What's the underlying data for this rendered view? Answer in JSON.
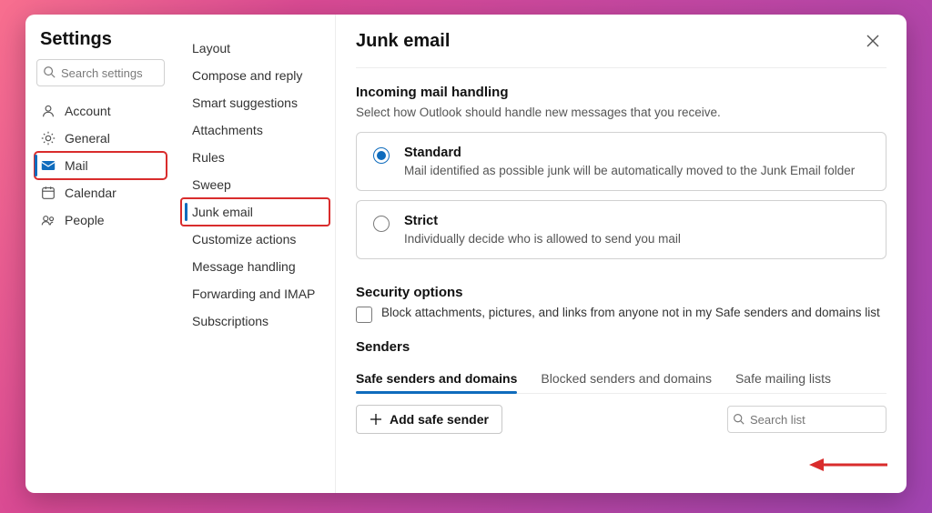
{
  "title": "Settings",
  "search": {
    "placeholder": "Search settings"
  },
  "nav": {
    "items": [
      {
        "label": "Account",
        "icon": "person"
      },
      {
        "label": "General",
        "icon": "gear"
      },
      {
        "label": "Mail",
        "icon": "mail",
        "active": true,
        "highlight": true
      },
      {
        "label": "Calendar",
        "icon": "calendar"
      },
      {
        "label": "People",
        "icon": "people"
      }
    ]
  },
  "subnav": {
    "items": [
      {
        "label": "Layout"
      },
      {
        "label": "Compose and reply"
      },
      {
        "label": "Smart suggestions"
      },
      {
        "label": "Attachments"
      },
      {
        "label": "Rules"
      },
      {
        "label": "Sweep"
      },
      {
        "label": "Junk email",
        "active": true,
        "highlight": true
      },
      {
        "label": "Customize actions"
      },
      {
        "label": "Message handling"
      },
      {
        "label": "Forwarding and IMAP"
      },
      {
        "label": "Subscriptions"
      }
    ]
  },
  "page": {
    "title": "Junk email",
    "incoming": {
      "heading": "Incoming mail handling",
      "desc": "Select how Outlook should handle new messages that you receive.",
      "options": [
        {
          "title": "Standard",
          "desc": "Mail identified as possible junk will be automatically moved to the Junk Email folder",
          "checked": true
        },
        {
          "title": "Strict",
          "desc": "Individually decide who is allowed to send you mail",
          "checked": false
        }
      ]
    },
    "security": {
      "heading": "Security options",
      "check_label": "Block attachments, pictures, and links from anyone not in my Safe senders and domains list",
      "checked": false
    },
    "senders": {
      "heading": "Senders",
      "tabs": [
        {
          "label": "Safe senders and domains",
          "active": true
        },
        {
          "label": "Blocked senders and domains"
        },
        {
          "label": "Safe mailing lists"
        }
      ],
      "add_label": "Add safe sender",
      "search_placeholder": "Search list"
    }
  }
}
